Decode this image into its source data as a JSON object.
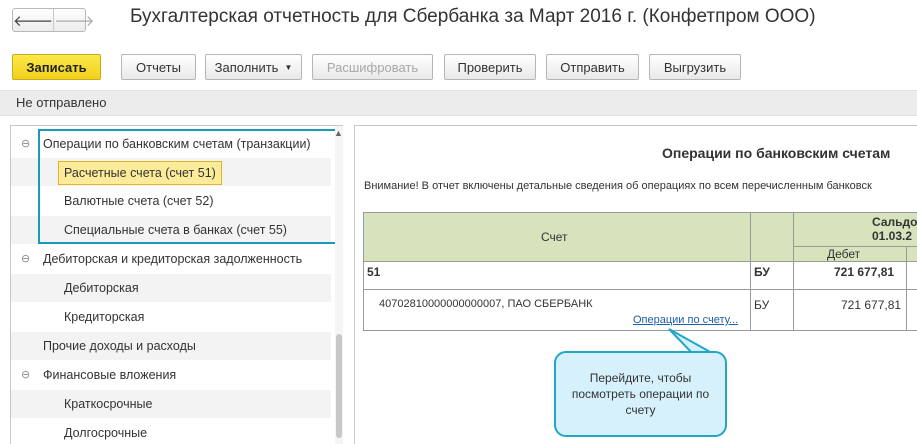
{
  "header": {
    "back_icon": "arrow-left-icon",
    "forward_icon": "arrow-right-icon",
    "title": "Бухгалтерская отчетность для Сбербанка за Март 2016 г. (Конфетпром ООО)"
  },
  "toolbar": {
    "save": "Записать",
    "reports": "Отчеты",
    "fill": "Заполнить",
    "decode": "Расшифровать",
    "check": "Проверить",
    "send": "Отправить",
    "export": "Выгрузить"
  },
  "status": "Не отправлено",
  "tree": {
    "items": [
      {
        "label": "Операции по банковским счетам (транзакции)",
        "expand": "⊖"
      },
      {
        "label": "Расчетные счета (счет 51)"
      },
      {
        "label": "Валютные счета (счет 52)"
      },
      {
        "label": "Специальные счета в банках (счет 55)"
      },
      {
        "label": "Дебиторская и кредиторская задолженность",
        "expand": "⊖"
      },
      {
        "label": "Дебиторская"
      },
      {
        "label": "Кредиторская"
      },
      {
        "label": "Прочие доходы и расходы"
      },
      {
        "label": "Финансовые вложения",
        "expand": "⊖"
      },
      {
        "label": "Краткосрочные"
      },
      {
        "label": "Долгосрочные"
      }
    ]
  },
  "report": {
    "title": "Операции по банковским счетам",
    "note": "Внимание! В отчет включены детальные сведения об операциях по всем перечисленным банковск",
    "columns": {
      "account": "Счет",
      "saldo": "Сальдо",
      "saldo_date": "01.03.2",
      "debit": "Дебет"
    },
    "rows": [
      {
        "account": "51",
        "type": "БУ",
        "debit": "721 677,81"
      },
      {
        "account": "40702810000000000007, ПАО СБЕРБАНК",
        "type": "БУ",
        "debit": "721 677,81",
        "link": "Операции по счету..."
      }
    ]
  },
  "callout": "Перейдите, чтобы посмотреть операции по счету",
  "colors": {
    "accent": "#1a9bb5",
    "primary_button": "#f2d11a",
    "table_header": "#d7e3bd"
  }
}
